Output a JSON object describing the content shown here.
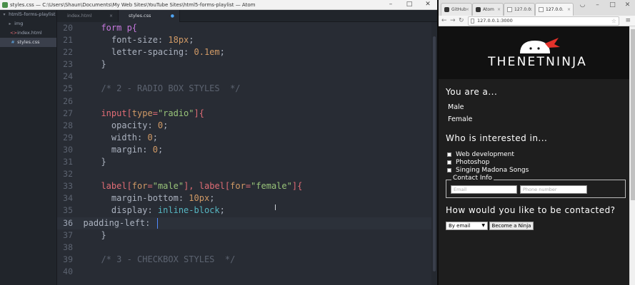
{
  "atom": {
    "window_title": "styles.css — C:\\Users\\Shaun\\Documents\\My Web Sites\\YouTube Sites\\html5-forms-playlist — Atom",
    "tree": [
      {
        "label": "html5-forms-playlist",
        "icon": "folder-icon",
        "glyph": "▾"
      },
      {
        "label": "img",
        "icon": "folder-icon",
        "glyph": "▸"
      },
      {
        "label": "index.html",
        "icon": "html-file-icon",
        "glyph": "<>"
      },
      {
        "label": "styles.css",
        "icon": "css-file-icon",
        "glyph": "#",
        "selected": true
      }
    ],
    "tabs": [
      {
        "label": "index.html",
        "close": "×"
      },
      {
        "label": "styles.css",
        "close": "●",
        "active": true
      }
    ],
    "code_lines": [
      {
        "num": "20",
        "parts": [
          [
            "  form p{",
            "#c678dd"
          ]
        ]
      },
      {
        "num": "21",
        "parts": [
          [
            "    font-size: ",
            "#abb2bf"
          ],
          [
            "18px",
            "#d19a66"
          ],
          [
            ";",
            "#abb2bf"
          ]
        ]
      },
      {
        "num": "22",
        "parts": [
          [
            "    letter-spacing: ",
            "#abb2bf"
          ],
          [
            "0.1em",
            "#d19a66"
          ],
          [
            ";",
            "#abb2bf"
          ]
        ]
      },
      {
        "num": "23",
        "parts": [
          [
            "  }",
            "#abb2bf"
          ]
        ]
      },
      {
        "num": "24",
        "parts": []
      },
      {
        "num": "25",
        "parts": [
          [
            "  /* 2 - RADIO BOX STYLES  */",
            "#5c6370"
          ]
        ]
      },
      {
        "num": "26",
        "parts": []
      },
      {
        "num": "27",
        "parts": [
          [
            "  input[",
            "#e06c75"
          ],
          [
            "type",
            "#d19a66"
          ],
          [
            "=",
            "#e06c75"
          ],
          [
            "\"radio\"",
            "#98c379"
          ],
          [
            "]{",
            "#e06c75"
          ]
        ]
      },
      {
        "num": "28",
        "parts": [
          [
            "    opacity: ",
            "#abb2bf"
          ],
          [
            "0",
            "#d19a66"
          ],
          [
            ";",
            "#abb2bf"
          ]
        ]
      },
      {
        "num": "29",
        "parts": [
          [
            "    width: ",
            "#abb2bf"
          ],
          [
            "0",
            "#d19a66"
          ],
          [
            ";",
            "#abb2bf"
          ]
        ]
      },
      {
        "num": "30",
        "parts": [
          [
            "    margin: ",
            "#abb2bf"
          ],
          [
            "0",
            "#d19a66"
          ],
          [
            ";",
            "#abb2bf"
          ]
        ]
      },
      {
        "num": "31",
        "parts": [
          [
            "  }",
            "#abb2bf"
          ]
        ]
      },
      {
        "num": "32",
        "parts": []
      },
      {
        "num": "33",
        "parts": [
          [
            "  label[",
            "#e06c75"
          ],
          [
            "for",
            "#d19a66"
          ],
          [
            "=",
            "#e06c75"
          ],
          [
            "\"male\"",
            "#98c379"
          ],
          [
            "], ",
            "#e06c75"
          ],
          [
            "label[",
            "#e06c75"
          ],
          [
            "for",
            "#d19a66"
          ],
          [
            "=",
            "#e06c75"
          ],
          [
            "\"female\"",
            "#98c379"
          ],
          [
            "]{",
            "#e06c75"
          ]
        ]
      },
      {
        "num": "34",
        "parts": [
          [
            "    margin-bottom: ",
            "#abb2bf"
          ],
          [
            "10px",
            "#d19a66"
          ],
          [
            ";",
            "#abb2bf"
          ]
        ]
      },
      {
        "num": "35",
        "parts": [
          [
            "    display: ",
            "#abb2bf"
          ],
          [
            "inline-block",
            "#56b6c2"
          ],
          [
            ";",
            "#abb2bf"
          ]
        ]
      },
      {
        "num": "36",
        "parts": [
          [
            "  padding-left: ",
            "#abb2bf"
          ]
        ],
        "cursor": true
      },
      {
        "num": "37",
        "parts": [
          [
            "  }",
            "#abb2bf"
          ]
        ]
      },
      {
        "num": "38",
        "parts": []
      },
      {
        "num": "39",
        "parts": [
          [
            "  /* 3 - CHECKBOX STYLES  */",
            "#5c6370"
          ]
        ]
      },
      {
        "num": "40",
        "parts": []
      }
    ]
  },
  "chrome": {
    "tabs": [
      {
        "label": "GitHub"
      },
      {
        "label": "Atom"
      },
      {
        "label": "127.0.0."
      },
      {
        "label": "127.0.0.",
        "active": true
      }
    ],
    "url": "127.0.0.1:3000"
  },
  "page": {
    "logo_text": "THENETNINJA",
    "you_are": "You are a...",
    "male": "Male",
    "female": "Female",
    "interested": "Who is interested in...",
    "interests": [
      "Web development",
      "Photoshop",
      "Singing Madona Songs"
    ],
    "contact_legend": "Contact Info",
    "email_placeholder": "Email",
    "phone_placeholder": "Phone number",
    "contacted": "How would you like to be contacted?",
    "select_value": "By email",
    "submit": "Become a Ninja"
  },
  "colors": {
    "editor_bg": "#282c34",
    "logo_bandana": "#e4322b"
  }
}
